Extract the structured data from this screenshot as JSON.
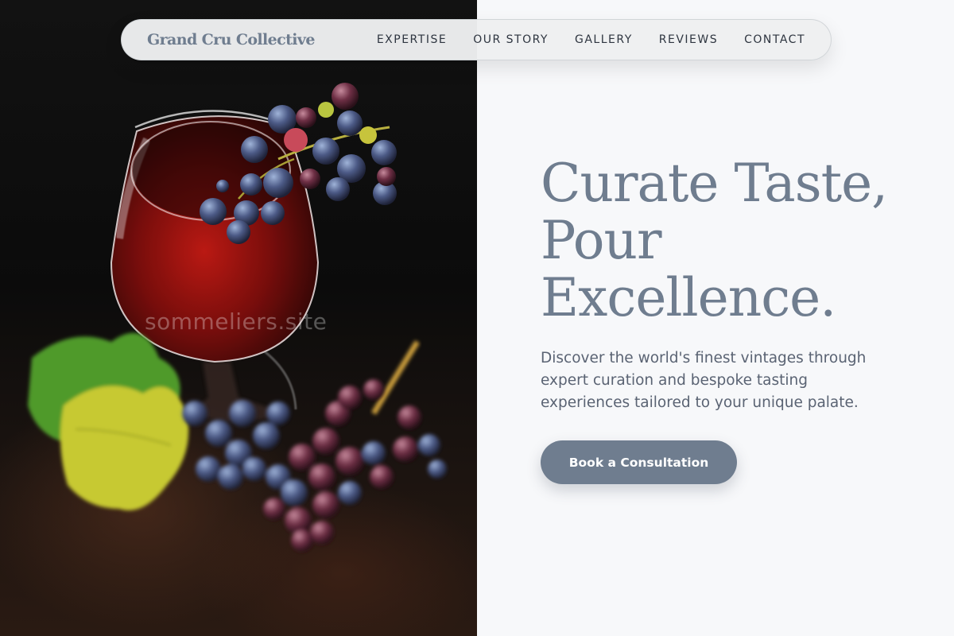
{
  "brand": {
    "name": "Grand Cru Collective"
  },
  "nav": {
    "links": [
      "EXPERTISE",
      "OUR STORY",
      "GALLERY",
      "REVIEWS",
      "CONTACT"
    ]
  },
  "hero": {
    "headline_line1": "Curate Taste,",
    "headline_line2": "Pour",
    "headline_line3": "Excellence.",
    "subtitle": "Discover the world's finest vintages through expert curation and bespoke tasting experiences tailored to your unique palate.",
    "cta_label": "Book a Consultation"
  },
  "photo": {
    "watermark": "sommeliers.site",
    "subject": "wine-glass-with-grapes"
  },
  "colors": {
    "accent": "#6f7d8f",
    "background": "#f7f8fa",
    "nav_text": "#2e3540",
    "body_text": "#5a6373"
  }
}
